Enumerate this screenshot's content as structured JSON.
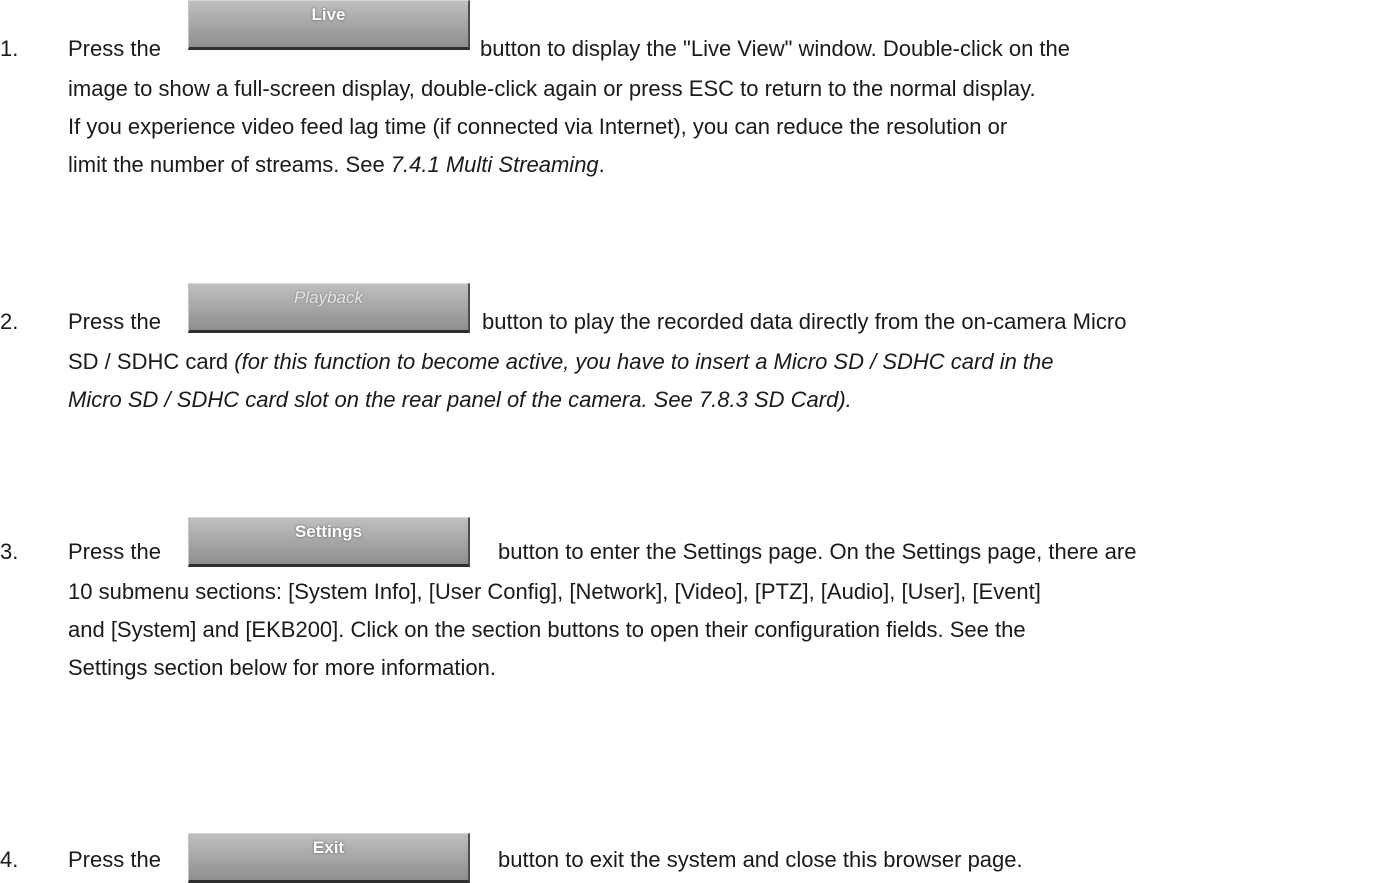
{
  "items": [
    {
      "number": "1.",
      "lead": "Press the",
      "button_label": "Live",
      "line1": "button to display the \"Live View\" window. Double-click on the",
      "lines": [
        "image to show a full-screen display, double-click again or press ESC to return to the normal display.",
        "If you experience video feed lag time (if connected via Internet), you can reduce the resolution or"
      ],
      "last_pre": "limit the number of streams. See ",
      "last_ref": "7.4.1 Multi Streaming",
      "last_post": "."
    },
    {
      "number": "2.",
      "lead": "Press the",
      "button_label": "Playback",
      "line1": "button to play the recorded data directly from the on-camera Micro",
      "line2_pre": "SD / SDHC card ",
      "line2_italic": "(for this function to become active, you have to insert a Micro SD / SDHC card in the",
      "line3_italic": "Micro SD / SDHC card slot on the rear panel of the camera. See 7.8.3 SD Card)."
    },
    {
      "number": "3.",
      "lead": "Press the",
      "button_label": "Settings",
      "line1": "button to enter the Settings page. On the Settings page, there are",
      "lines": [
        "10 submenu sections: [System Info], [User Config], [Network], [Video], [PTZ], [Audio], [User], [Event]",
        "and [System] and [EKB200]. Click on the section buttons to open their configuration fields. See the",
        "Settings section below for more information."
      ]
    },
    {
      "number": "4.",
      "lead": "Press the",
      "button_label": "Exit",
      "line1": "button to exit the system and close this browser page."
    }
  ]
}
